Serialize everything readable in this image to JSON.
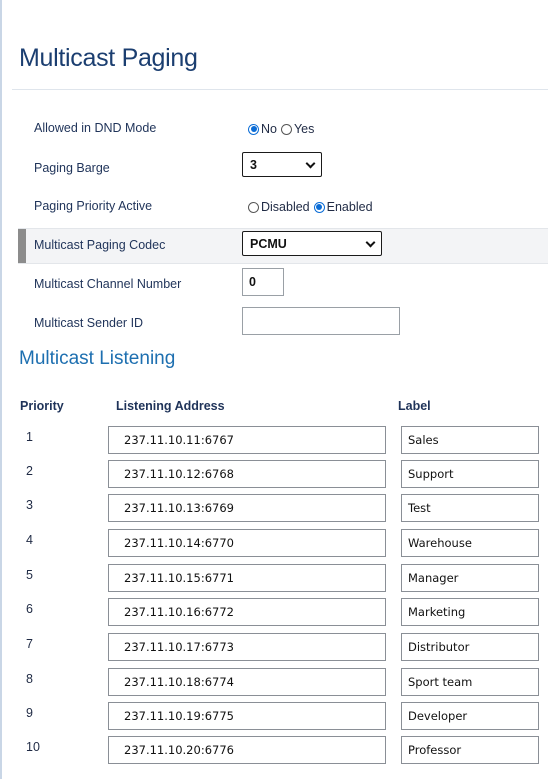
{
  "page_title": "Multicast Paging",
  "settings": {
    "dnd": {
      "label": "Allowed in DND Mode",
      "options": [
        {
          "label": "No",
          "selected": true
        },
        {
          "label": "Yes",
          "selected": false
        }
      ]
    },
    "barge": {
      "label": "Paging Barge",
      "value": "3"
    },
    "priority_active": {
      "label": "Paging Priority Active",
      "options": [
        {
          "label": "Disabled",
          "selected": false
        },
        {
          "label": "Enabled",
          "selected": true
        }
      ]
    },
    "codec": {
      "label": "Multicast Paging Codec",
      "value": "PCMU"
    },
    "channel": {
      "label": "Multicast Channel Number",
      "value": "0"
    },
    "sender_id": {
      "label": "Multicast Sender ID",
      "value": ""
    }
  },
  "listening": {
    "title": "Multicast Listening",
    "headers": {
      "priority": "Priority",
      "address": "Listening Address",
      "label": "Label"
    },
    "rows": [
      {
        "priority": "1",
        "address": "237.11.10.11:6767",
        "label": "Sales"
      },
      {
        "priority": "2",
        "address": "237.11.10.12:6768",
        "label": "Support"
      },
      {
        "priority": "3",
        "address": "237.11.10.13:6769",
        "label": "Test"
      },
      {
        "priority": "4",
        "address": "237.11.10.14:6770",
        "label": "Warehouse"
      },
      {
        "priority": "5",
        "address": "237.11.10.15:6771",
        "label": "Manager"
      },
      {
        "priority": "6",
        "address": "237.11.10.16:6772",
        "label": "Marketing"
      },
      {
        "priority": "7",
        "address": "237.11.10.17:6773",
        "label": "Distributor"
      },
      {
        "priority": "8",
        "address": "237.11.10.18:6774",
        "label": "Sport team"
      },
      {
        "priority": "9",
        "address": "237.11.10.19:6775",
        "label": "Developer"
      },
      {
        "priority": "10",
        "address": "237.11.10.20:6776",
        "label": "Professor"
      }
    ]
  },
  "colors": {
    "title": "#1b3e70",
    "section_title": "#1d6fb0",
    "radio_selected": "#0a6cd6",
    "label_text": "#1f3359"
  }
}
